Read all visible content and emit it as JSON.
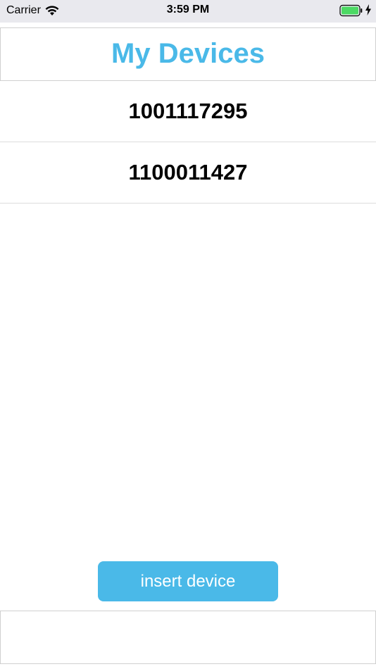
{
  "status_bar": {
    "carrier": "Carrier",
    "time": "3:59 PM",
    "wifi_icon": "wifi-icon",
    "battery_icon": "battery-icon",
    "charging_icon": "lightning-bolt-icon",
    "battery_color": "#4cd964"
  },
  "header": {
    "title": "My Devices",
    "title_color": "#4ab9e8"
  },
  "devices": [
    {
      "id": "1001117295"
    },
    {
      "id": "1100011427"
    }
  ],
  "actions": {
    "insert_label": "insert device",
    "button_color": "#4ab9e8"
  }
}
